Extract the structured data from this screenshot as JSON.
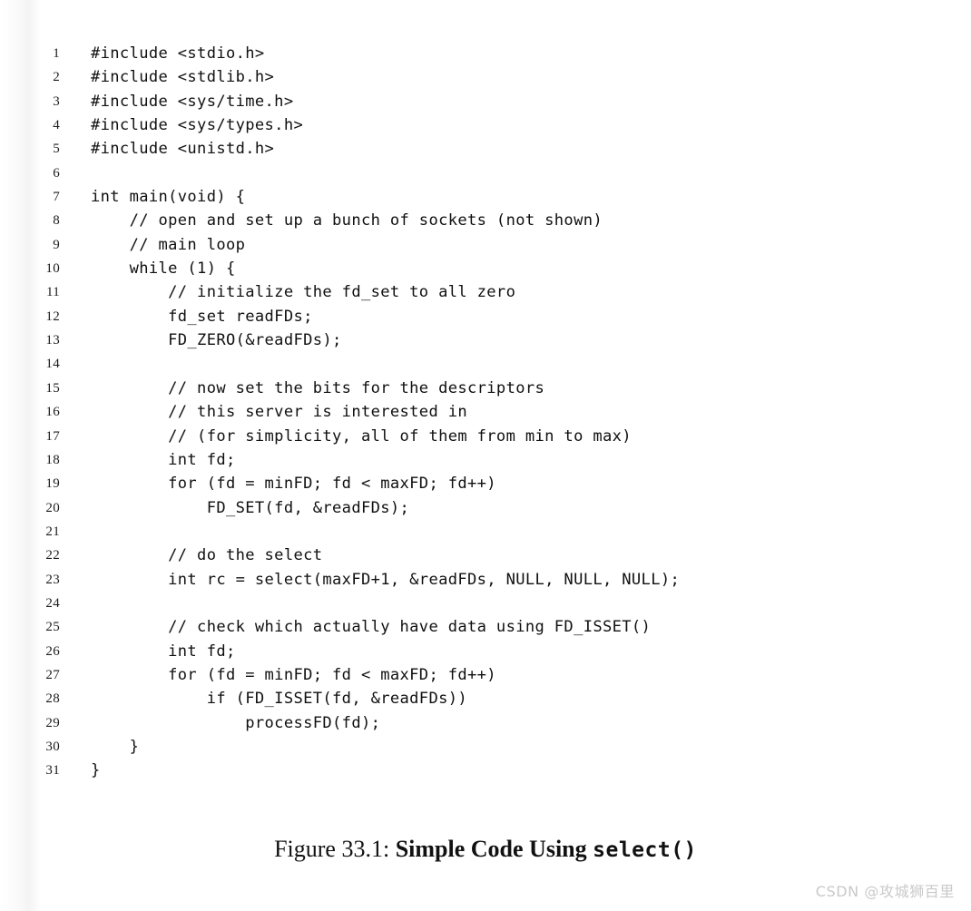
{
  "figure": {
    "caption_prefix": "Figure 33.1:",
    "caption_title": "Simple Code Using",
    "caption_code": "select()"
  },
  "watermark": {
    "text": "CSDN @攻城狮百里"
  },
  "code": {
    "language": "c",
    "lines": [
      {
        "n": "1",
        "text": "#include <stdio.h>"
      },
      {
        "n": "2",
        "text": "#include <stdlib.h>"
      },
      {
        "n": "3",
        "text": "#include <sys/time.h>"
      },
      {
        "n": "4",
        "text": "#include <sys/types.h>"
      },
      {
        "n": "5",
        "text": "#include <unistd.h>"
      },
      {
        "n": "6",
        "text": ""
      },
      {
        "n": "7",
        "text": "int main(void) {"
      },
      {
        "n": "8",
        "text": "    // open and set up a bunch of sockets (not shown)"
      },
      {
        "n": "9",
        "text": "    // main loop"
      },
      {
        "n": "10",
        "text": "    while (1) {"
      },
      {
        "n": "11",
        "text": "        // initialize the fd_set to all zero"
      },
      {
        "n": "12",
        "text": "        fd_set readFDs;"
      },
      {
        "n": "13",
        "text": "        FD_ZERO(&readFDs);"
      },
      {
        "n": "14",
        "text": ""
      },
      {
        "n": "15",
        "text": "        // now set the bits for the descriptors"
      },
      {
        "n": "16",
        "text": "        // this server is interested in"
      },
      {
        "n": "17",
        "text": "        // (for simplicity, all of them from min to max)"
      },
      {
        "n": "18",
        "text": "        int fd;"
      },
      {
        "n": "19",
        "text": "        for (fd = minFD; fd < maxFD; fd++)"
      },
      {
        "n": "20",
        "text": "            FD_SET(fd, &readFDs);"
      },
      {
        "n": "21",
        "text": ""
      },
      {
        "n": "22",
        "text": "        // do the select"
      },
      {
        "n": "23",
        "text": "        int rc = select(maxFD+1, &readFDs, NULL, NULL, NULL);"
      },
      {
        "n": "24",
        "text": ""
      },
      {
        "n": "25",
        "text": "        // check which actually have data using FD_ISSET()"
      },
      {
        "n": "26",
        "text": "        int fd;"
      },
      {
        "n": "27",
        "text": "        for (fd = minFD; fd < maxFD; fd++)"
      },
      {
        "n": "28",
        "text": "            if (FD_ISSET(fd, &readFDs))"
      },
      {
        "n": "29",
        "text": "                processFD(fd);"
      },
      {
        "n": "30",
        "text": "    }"
      },
      {
        "n": "31",
        "text": "}"
      }
    ]
  }
}
